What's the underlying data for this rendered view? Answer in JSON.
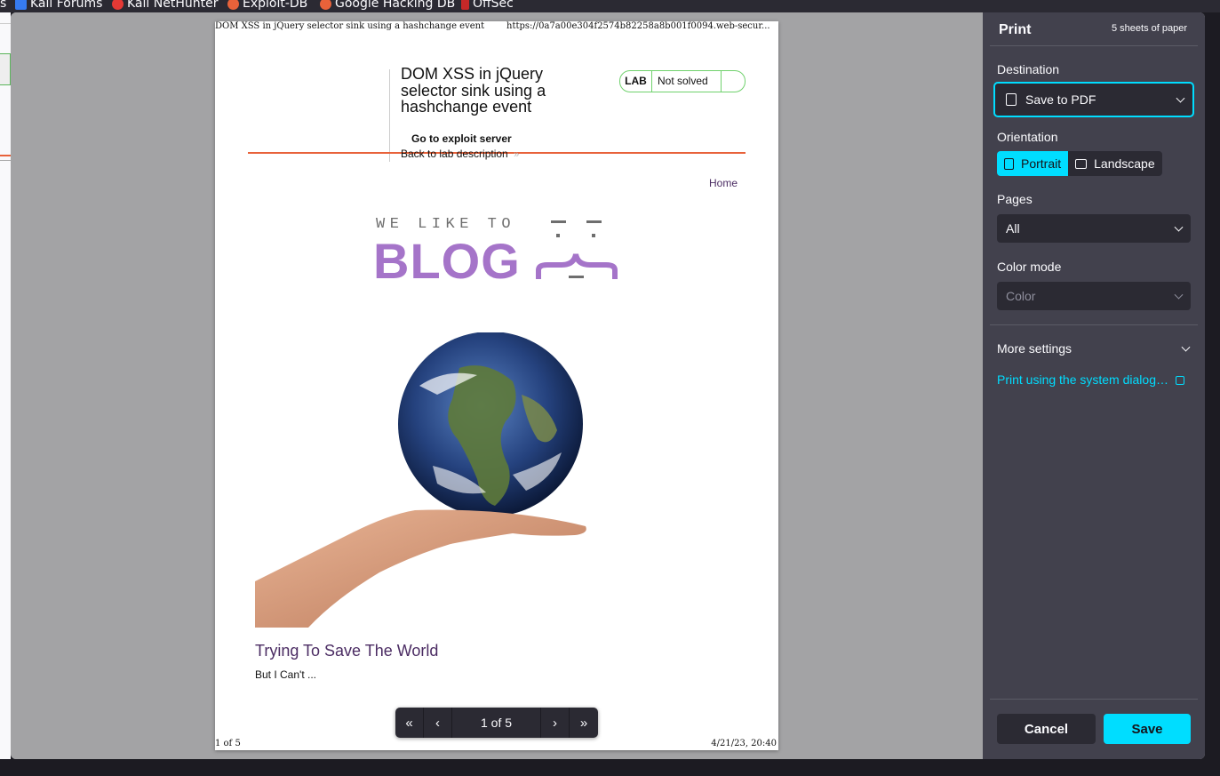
{
  "bookmarks": [
    {
      "label": "s",
      "icon": "none"
    },
    {
      "label": "Kali Forums",
      "icon": "kali-icon"
    },
    {
      "label": "Kali NetHunter",
      "icon": "nethunter-icon"
    },
    {
      "label": "Exploit-DB",
      "icon": "exploitdb-icon"
    },
    {
      "label": "Google Hacking DB",
      "icon": "exploitdb-icon"
    },
    {
      "label": "OffSec",
      "icon": "offsec-icon"
    }
  ],
  "preview": {
    "header_left": "DOM XSS in jQuery selector sink using a hashchange event",
    "header_right": "https://0a7a00e304f2574b82258a8b001f0094.web-secur...",
    "footer_left": "1 of 5",
    "footer_right": "4/21/23, 20:40",
    "lab_title": "DOM XSS in jQuery selector sink using a hashchange event",
    "lab_badge": "LAB",
    "lab_status": "Not solved",
    "exploit_link": "Go to exploit server",
    "back_link": "Back to lab description",
    "home_link": "Home",
    "blog_tagline": "WE LIKE TO",
    "blog_word": "BLOG",
    "post_title": "Trying To Save The World",
    "post_subtitle": "But I Can't ..."
  },
  "pager": {
    "first": "«",
    "prev": "‹",
    "page_label": "1 of 5",
    "next": "›",
    "last": "»"
  },
  "panel": {
    "title": "Print",
    "sheets": "5 sheets of paper",
    "destination_label": "Destination",
    "destination_value": "Save to PDF",
    "orientation_label": "Orientation",
    "orientation_portrait": "Portrait",
    "orientation_landscape": "Landscape",
    "pages_label": "Pages",
    "pages_value": "All",
    "color_label": "Color mode",
    "color_value": "Color",
    "more_settings": "More settings",
    "system_dialog": "Print using the system dialog…",
    "cancel": "Cancel",
    "save": "Save"
  },
  "colors": {
    "accent": "#00ddff",
    "panel_bg": "#42414d",
    "lab_green": "#70d16d",
    "header_orange": "#e8623a",
    "blog_purple": "#a574c9"
  }
}
